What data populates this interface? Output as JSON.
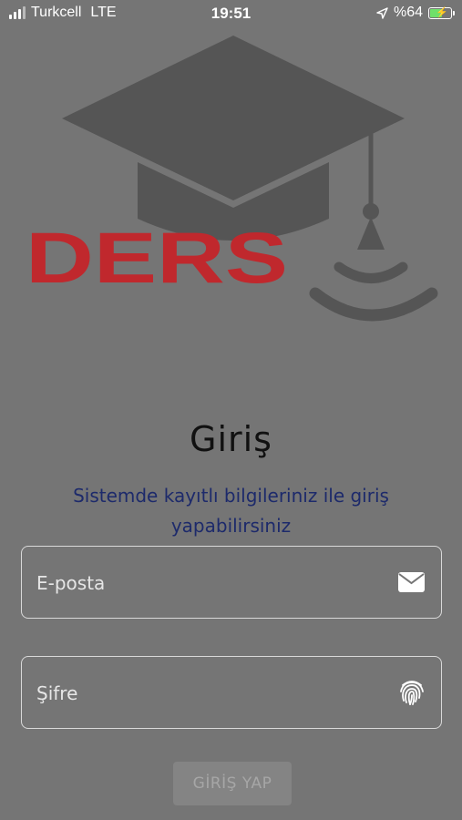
{
  "status_bar": {
    "carrier": "Turkcell",
    "network": "LTE",
    "time": "19:51",
    "battery": "%64",
    "battery_level": 0.64
  },
  "logo": {
    "brand": "DERS",
    "colors": {
      "brand_red": "#c0282d",
      "cap_gray": "#555555"
    }
  },
  "login": {
    "title": "Giriş",
    "subtitle_line1": "Sistemde kayıtlı bilgileriniz ile giriş",
    "subtitle_line2": "yapabilirsiniz",
    "email_placeholder": "E-posta",
    "password_placeholder": "Şifre",
    "submit_label": "GİRİŞ YAP",
    "icons": {
      "email": "mail-icon",
      "password": "fingerprint-icon"
    }
  },
  "colors": {
    "background": "#757575",
    "subtitle": "#1d2a6b"
  }
}
